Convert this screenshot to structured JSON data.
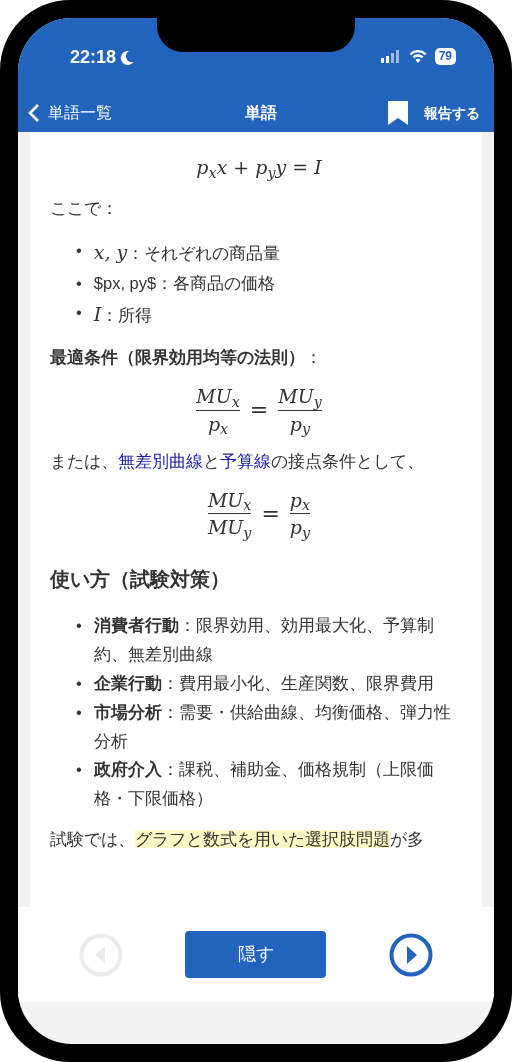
{
  "status_bar": {
    "time": "22:18",
    "battery": "79"
  },
  "nav": {
    "back_label": "単語一覧",
    "title": "単語",
    "report_label": "報告する"
  },
  "content": [
    {
      "kind": "equation",
      "terms": [
        {
          "kind": "math",
          "text": "p$_{x}$x + p$_{y}$y = I"
        }
      ]
    },
    {
      "kind": "paragraph",
      "segments": [
        {
          "kind": "text",
          "text": "ここで："
        }
      ]
    },
    {
      "kind": "list",
      "items": [
        {
          "kind": "math",
          "marker": "•",
          "term": "x, y",
          "text": "：それぞれの商品量"
        },
        {
          "kind": "plain",
          "marker": "•",
          "term": "$px, py$",
          "text": "：各商品の価格"
        },
        {
          "kind": "math",
          "marker": "•",
          "term": "I",
          "text": "：所得"
        }
      ]
    },
    {
      "kind": "paragraph",
      "segments": [
        {
          "kind": "bold",
          "text": "最適条件（限界効用均等の法則）"
        },
        {
          "kind": "text",
          "text": "："
        }
      ]
    },
    {
      "kind": "equation",
      "terms": [
        {
          "kind": "fraction",
          "numerator": "MU$_{x}$",
          "denominator": "p$_{x}$"
        },
        {
          "kind": "operator",
          "text": "="
        },
        {
          "kind": "fraction",
          "numerator": "MU$_{y}$",
          "denominator": "p$_{y}$"
        }
      ]
    },
    {
      "kind": "paragraph",
      "segments": [
        {
          "kind": "text",
          "text": "または、"
        },
        {
          "kind": "link",
          "text": "無差別曲線"
        },
        {
          "kind": "text",
          "text": "と"
        },
        {
          "kind": "link",
          "text": "予算線"
        },
        {
          "kind": "text",
          "text": "の接点条件として、"
        }
      ]
    },
    {
      "kind": "equation",
      "terms": [
        {
          "kind": "fraction",
          "numerator": "MU$_{x}$",
          "denominator": "MU$_{y}$"
        },
        {
          "kind": "operator",
          "text": "="
        },
        {
          "kind": "fraction",
          "numerator": "p$_{x}$",
          "denominator": "p$_{y}$"
        }
      ]
    },
    {
      "kind": "heading",
      "text": "使い方（試験対策）"
    },
    {
      "kind": "list",
      "items": [
        {
          "kind": "bold",
          "marker": "•",
          "term": "消費者行動",
          "text": "：限界効用、効用最大化、予算制約、無差別曲線"
        },
        {
          "kind": "bold",
          "marker": "•",
          "term": "企業行動",
          "text": "：費用最小化、生産関数、限界費用"
        },
        {
          "kind": "bold",
          "marker": "•",
          "term": "市場分析",
          "text": "：需要・供給曲線、均衡価格、弾力性分析"
        },
        {
          "kind": "bold",
          "marker": "•",
          "term": "政府介入",
          "text": "：課税、補助金、価格規制（上限価格・下限価格）"
        }
      ]
    },
    {
      "kind": "paragraph",
      "segments": [
        {
          "kind": "text",
          "text": "試験では、"
        },
        {
          "kind": "highlight",
          "text": "グラフと数式を用いた選択肢問題"
        },
        {
          "kind": "text",
          "text": "が多"
        }
      ]
    }
  ],
  "footer": {
    "prev": {
      "disabled": true
    },
    "button": "隠す",
    "next": {
      "disabled": false
    }
  }
}
